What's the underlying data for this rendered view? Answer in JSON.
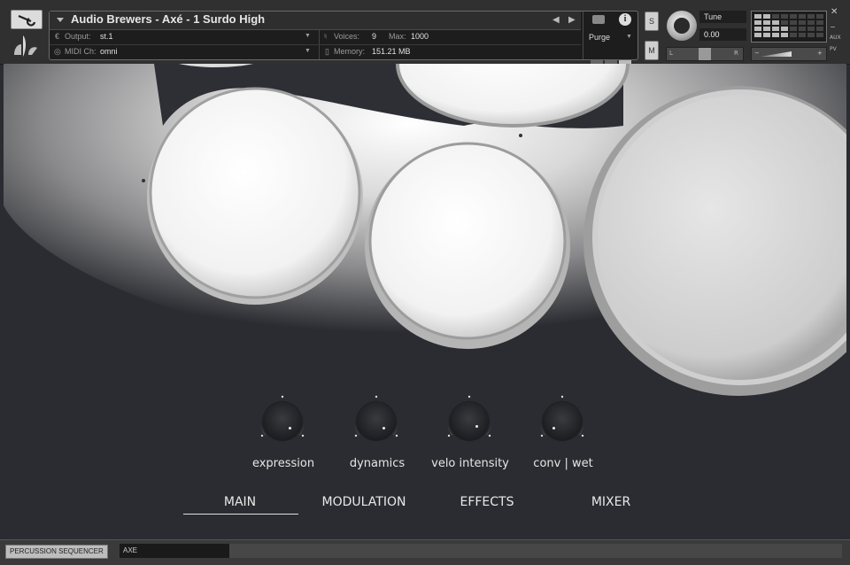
{
  "header": {
    "instrument_title": "Audio Brewers - Axé - 1 Surdo High",
    "output_label": "Output:",
    "output_value": "st.1",
    "voices_label": "Voices:",
    "voices_value": "9",
    "max_label": "Max:",
    "max_value": "1000",
    "midi_label": "MIDI Ch:",
    "midi_value": "omni",
    "memory_label": "Memory:",
    "memory_value": "151.21 MB",
    "purge_label": "Purge",
    "solo_label": "S",
    "mute_label": "M",
    "tune_label": "Tune",
    "tune_value": "0.00",
    "pan_left": "L",
    "pan_right": "R",
    "aux_label": "AUX",
    "pv_label": "PV"
  },
  "knobs": [
    {
      "label": "expression"
    },
    {
      "label": "dynamics"
    },
    {
      "label": "velo intensity"
    },
    {
      "label": "conv | wet"
    }
  ],
  "tabs": [
    {
      "label": "MAIN",
      "active": true
    },
    {
      "label": "MODULATION",
      "active": false
    },
    {
      "label": "EFFECTS",
      "active": false
    },
    {
      "label": "MIXER",
      "active": false
    }
  ],
  "footer": {
    "sequencer_tab": "PERCUSSION SEQUENCER",
    "axe_tab": "AXE"
  },
  "colors": {
    "background": "#2b2c31",
    "text": "#e8e8e8",
    "header": "#303030"
  }
}
